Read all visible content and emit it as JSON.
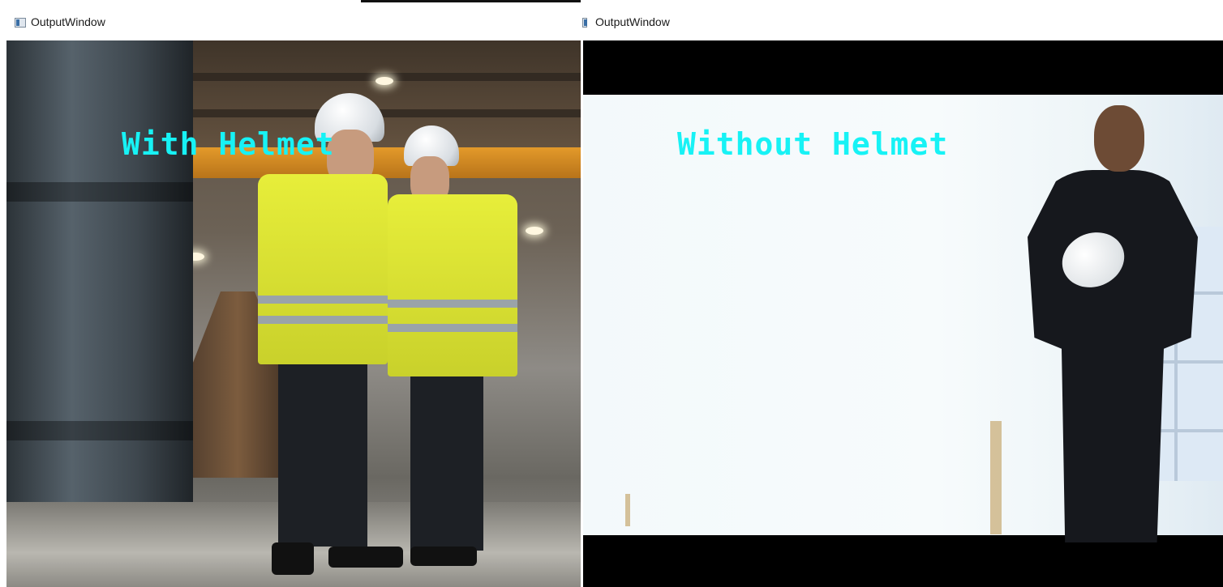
{
  "windows": {
    "left": {
      "title": "OutputWindow",
      "label": "With Helmet"
    },
    "right": {
      "title": "OutputWindow",
      "label": "Without Helmet"
    }
  },
  "colors": {
    "label_text": "#17f2f5",
    "titlebar_bg": "#ffffff",
    "letterbox": "#000000"
  },
  "icons": {
    "window_icon": "app-window-icon"
  }
}
